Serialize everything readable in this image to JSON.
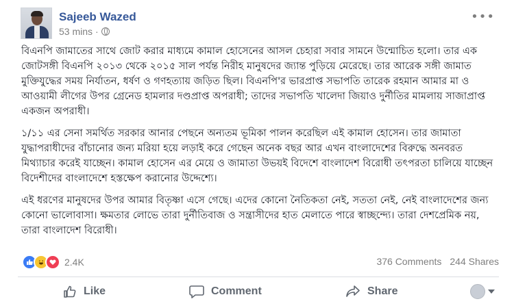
{
  "post": {
    "author": "Sajeeb Wazed",
    "time": "53 mins",
    "menu_icon": "more-dots-icon",
    "paragraphs": [
      "বিএনপি জামাতের সাথে জোট করার মাধ্যমে কামাল হোসেনের আসল চেহারা সবার সামনে উন্মোচিত হলো। তার এক জোটসঙ্গী বিএনপি ২০১৩ থেকে ২০১৫ সাল পর্যন্ত নিরীহ মানুষদের জ্যান্ত পুড়িয়ে মেরেছে। তার আরেক সঙ্গী জামাত মুক্তিযুদ্ধের সময় নির্যাতন, ধর্ষণ ও গণহত্যায় জড়িত ছিল। বিএনপি'র ভারপ্রাপ্ত সভাপতি তারেক রহমান আমার মা ও আওয়ামী লীগের উপর গ্রেনেড হামলার দণ্ডপ্রাপ্ত অপরাধী; তাদের সভাপতি খালেদা জিয়াও দুর্নীতির মামলায় সাজাপ্রাপ্ত একজন অপরাধী।",
      "১/১১ এর সেনা সমর্থিত সরকার আনার পেছনে অন্যতম ভূমিকা পালন করেছিল এই কামাল হোসেন। তার জামাতা যুদ্ধাপরাধীদের বাঁচানোর জন্য মরিয়া হয়ে লড়াই করে গেছেন অনেক বছর আর এখন বাংলাদেশের বিরুদ্ধে অনবরত মিথ্যাচার করেই যাচ্ছেন। কামাল হোসেন এর মেয়ে ও জামাতা উভয়ই বিদেশে বাংলাদেশ বিরোধী তৎপরতা চালিয়ে যাচ্ছেন বিদেশীদের বাংলাদেশে হস্তক্ষেপ করানোর উদ্দেশ্যে।",
      "এই ধরণের মানুষদের উপর আমার বিতৃষ্ণা এসে গেছে। এদের কোনো নৈতিকতা নেই, সততা নেই, নেই বাংলাদেশের জন্য কোনো ভালোবাসা। ক্ষমতার লোভে তারা দুর্নীতিবাজ ও সন্ত্রাসীদের হাত মেলাতে পারে স্বাচ্ছন্দ্যে। তারা দেশপ্রেমিক নয়, তারা বাংলাদেশ বিরোধী।"
    ]
  },
  "reactions": {
    "icons": [
      "like-reaction-icon",
      "haha-reaction-icon",
      "love-reaction-icon"
    ],
    "count": "2.4K"
  },
  "stats": {
    "comments": "376 Comments",
    "shares": "244 Shares"
  },
  "actions": {
    "like": "Like",
    "comment": "Comment",
    "share": "Share"
  },
  "colors": {
    "author": "#365899",
    "muted": "#7f7f7f",
    "like_reaction": "#3b7cf5",
    "love_reaction": "#ef3e54",
    "haha_reaction": "#f7c533"
  }
}
